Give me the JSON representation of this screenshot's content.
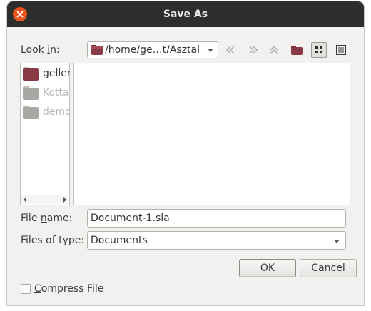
{
  "window": {
    "title": "Save As",
    "close_icon": "close-icon"
  },
  "look_in": {
    "label_pre": "Look ",
    "label_mnemonic": "i",
    "label_post": "n:",
    "path": "/home/ge…t/Asztal",
    "icons": [
      "back-arrow-icon",
      "forward-arrow-icon",
      "parent-directory-icon",
      "new-folder-icon",
      "icon-view-icon",
      "detail-view-icon"
    ]
  },
  "sidebar": {
    "items": [
      {
        "label": "geller",
        "icon": "home-folder-icon",
        "color": "#8a3a45",
        "disabled": false
      },
      {
        "label": "Kotta",
        "icon": "folder-icon",
        "color": "#a9a7a4",
        "disabled": true
      },
      {
        "label": "demo",
        "icon": "folder-icon",
        "color": "#a9a7a4",
        "disabled": true
      }
    ]
  },
  "file_name": {
    "label_pre": "File ",
    "label_mnemonic": "n",
    "label_post": "ame:",
    "value": "Document-1.sla"
  },
  "file_type": {
    "label": "Files of type:",
    "value": "Documents"
  },
  "buttons": {
    "ok_mnemonic": "O",
    "ok_rest": "K",
    "cancel_mnemonic": "C",
    "cancel_rest": "ancel"
  },
  "compress": {
    "label_mnemonic": "C",
    "label_rest": "ompress File",
    "checked": false
  },
  "colors": {
    "accent": "#e95420",
    "titlebar": "#2e2e2c"
  }
}
